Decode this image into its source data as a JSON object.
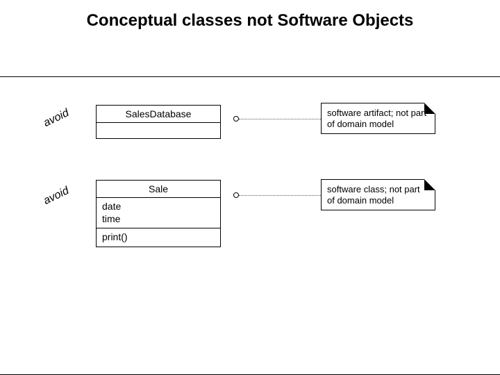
{
  "title": "Conceptual classes not Software Objects",
  "labels": {
    "avoid": "avoid"
  },
  "classes": {
    "salesDatabase": {
      "name": "SalesDatabase",
      "attributes": [],
      "operations": []
    },
    "sale": {
      "name": "Sale",
      "attributes": [
        "date",
        "time"
      ],
      "operations": [
        "print()"
      ]
    }
  },
  "notes": {
    "artifact": "software artifact; not part of domain model",
    "class": "software class; not part of domain model"
  }
}
